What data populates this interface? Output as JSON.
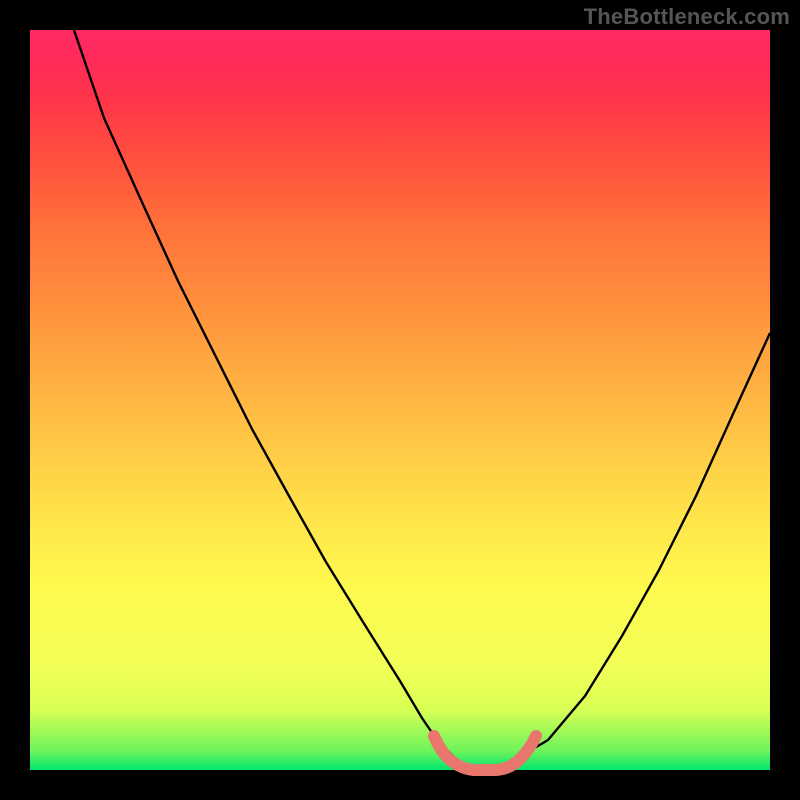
{
  "watermark": "TheBottleneck.com",
  "chart_data": {
    "type": "line",
    "title": "",
    "xlabel": "",
    "ylabel": "",
    "xlim": [
      0,
      100
    ],
    "ylim": [
      0,
      100
    ],
    "series": [
      {
        "name": "curve",
        "x": [
          6,
          10,
          15,
          20,
          25,
          30,
          35,
          40,
          45,
          50,
          53,
          55,
          58,
          60,
          63,
          65,
          70,
          75,
          80,
          85,
          90,
          95,
          100
        ],
        "y": [
          100,
          88,
          77,
          66,
          56,
          46,
          37,
          28,
          20,
          12,
          7,
          4,
          1,
          0,
          0,
          1,
          4,
          10,
          18,
          27,
          37,
          48,
          59
        ]
      }
    ],
    "annotations": [
      {
        "name": "flat-bottom-highlight",
        "x_range": [
          55,
          65
        ],
        "y": 0
      }
    ],
    "gradient_stops": [
      {
        "pos": 0,
        "color": "#00e66f"
      },
      {
        "pos": 0.13,
        "color": "#f0ff57"
      },
      {
        "pos": 0.5,
        "color": "#ffb342"
      },
      {
        "pos": 1.0,
        "color": "#ff2a63"
      }
    ]
  }
}
